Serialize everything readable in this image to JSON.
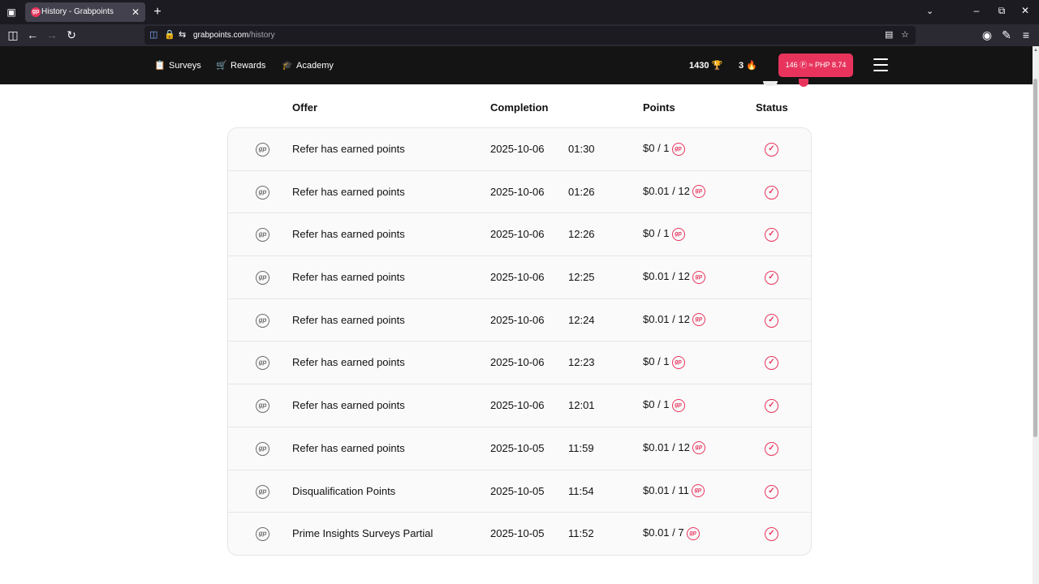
{
  "browser": {
    "tab_title": "History - Grabpoints",
    "tab_favicon_text": "gp",
    "url_domain": "grabpoints.com",
    "url_path": "/history"
  },
  "site": {
    "nav": [
      {
        "label": "Surveys",
        "icon": "clipboard-icon"
      },
      {
        "label": "Rewards",
        "icon": "cart-icon"
      },
      {
        "label": "Academy",
        "icon": "graduation-cap-icon"
      }
    ],
    "points": "1430",
    "streak": "3",
    "balance_label": "146 Ⓟ ≈ PHP 8.74",
    "accent_color": "#e8345d"
  },
  "table": {
    "headers": {
      "offer": "Offer",
      "completion": "Completion",
      "points": "Points",
      "status": "Status"
    },
    "rows": [
      {
        "offer": "Refer has earned points",
        "date": "2025-10-06",
        "time": "01:30",
        "points": "$0 / 1",
        "status": "completed"
      },
      {
        "offer": "Refer has earned points",
        "date": "2025-10-06",
        "time": "01:26",
        "points": "$0.01 / 12",
        "status": "completed"
      },
      {
        "offer": "Refer has earned points",
        "date": "2025-10-06",
        "time": "12:26",
        "points": "$0 / 1",
        "status": "completed"
      },
      {
        "offer": "Refer has earned points",
        "date": "2025-10-06",
        "time": "12:25",
        "points": "$0.01 / 12",
        "status": "completed"
      },
      {
        "offer": "Refer has earned points",
        "date": "2025-10-06",
        "time": "12:24",
        "points": "$0.01 / 12",
        "status": "completed"
      },
      {
        "offer": "Refer has earned points",
        "date": "2025-10-06",
        "time": "12:23",
        "points": "$0 / 1",
        "status": "completed"
      },
      {
        "offer": "Refer has earned points",
        "date": "2025-10-06",
        "time": "12:01",
        "points": "$0 / 1",
        "status": "completed"
      },
      {
        "offer": "Refer has earned points",
        "date": "2025-10-05",
        "time": "11:59",
        "points": "$0.01 / 12",
        "status": "completed"
      },
      {
        "offer": "Disqualification Points",
        "date": "2025-10-05",
        "time": "11:54",
        "points": "$0.01 / 11",
        "status": "completed"
      },
      {
        "offer": "Prime Insights Surveys Partial",
        "date": "2025-10-05",
        "time": "11:52",
        "points": "$0.01 / 7",
        "status": "completed"
      }
    ]
  }
}
